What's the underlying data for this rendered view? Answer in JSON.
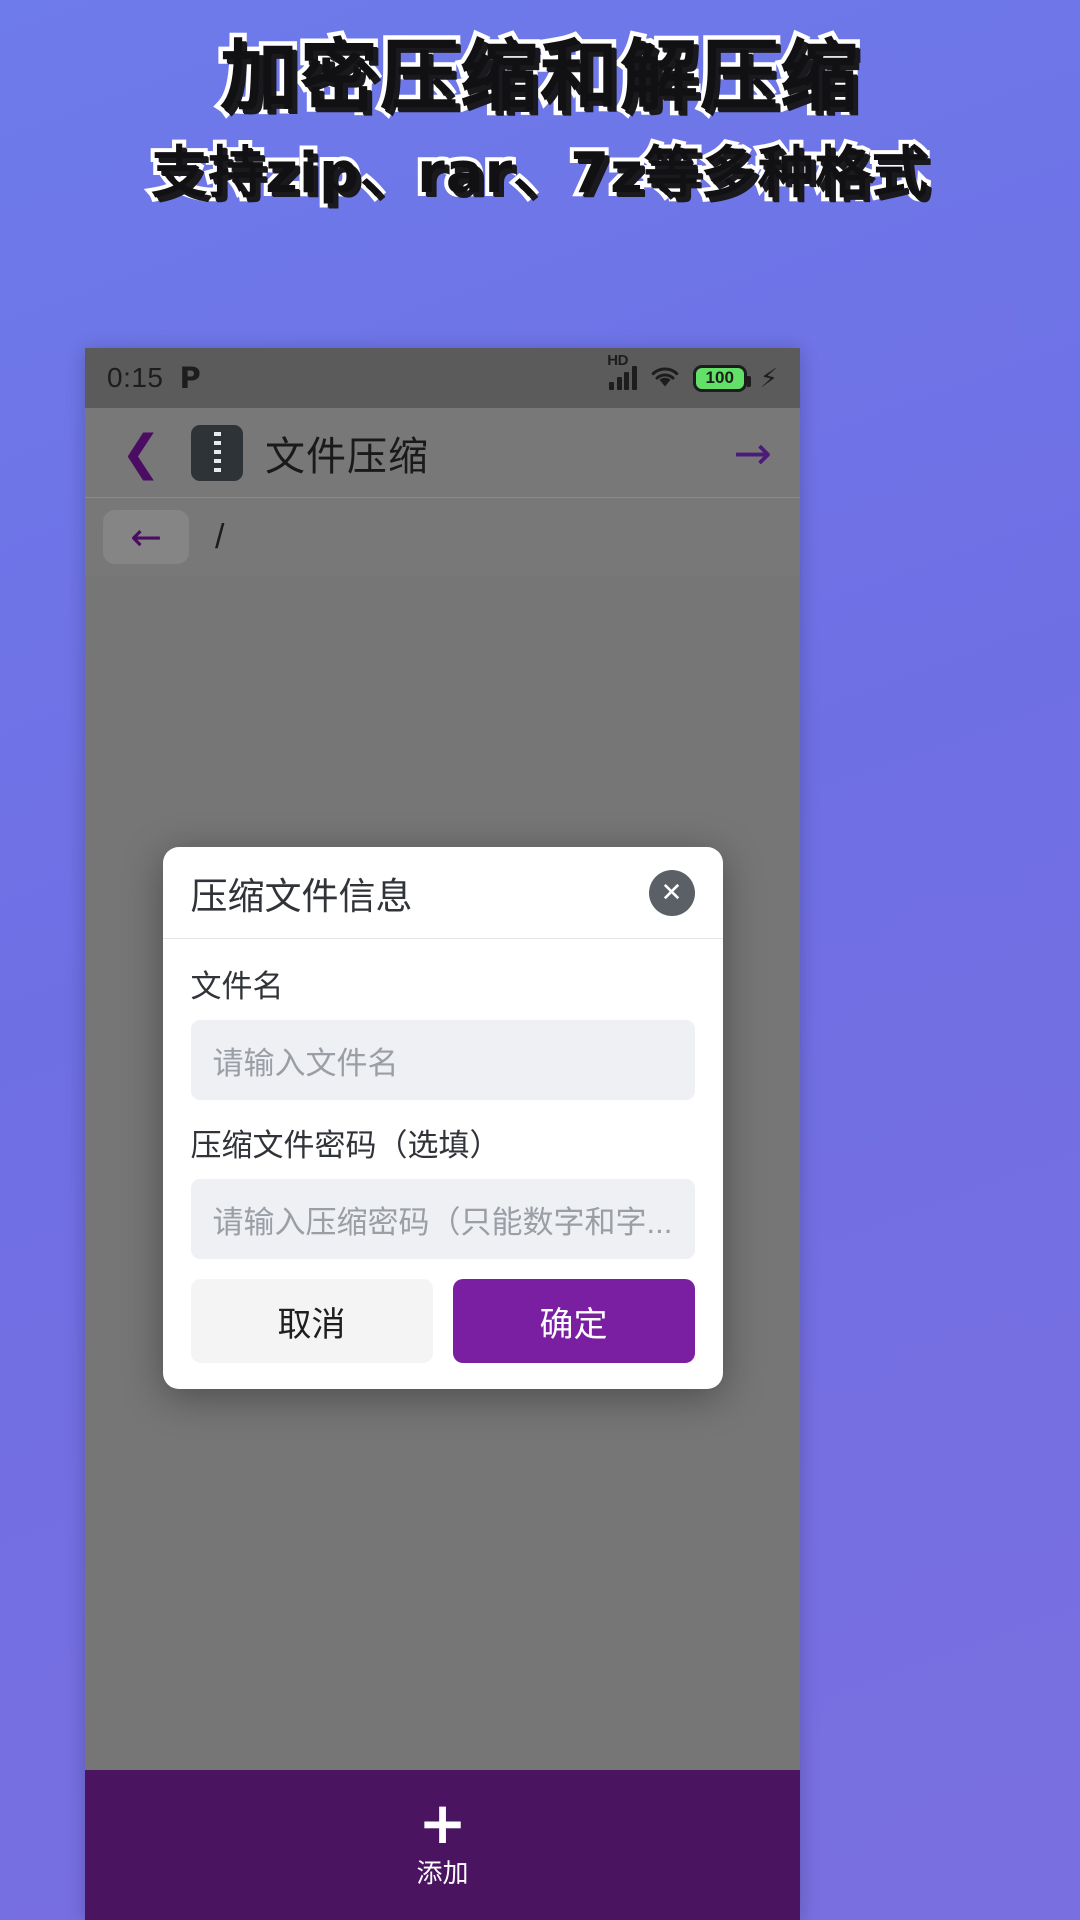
{
  "promo": {
    "title": "加密压缩和解压缩",
    "subtitle": "支持zip、rar、7z等多种格式",
    "bg_color": "#6f6fe4"
  },
  "statusbar": {
    "time": "0:15",
    "app_badge": "P",
    "network_label": "HD",
    "signal_icon": "signal-bars-icon",
    "wifi_icon": "wifi-icon",
    "battery_level": "100",
    "battery_color": "#63e067",
    "charging_icon": "lightning-bolt-icon"
  },
  "appbar": {
    "back_icon": "chevron-left-icon",
    "app_icon": "zip-archive-icon",
    "title": "文件压缩",
    "forward_icon": "arrow-right-icon",
    "accent_color": "#4a1b7a"
  },
  "pathbar": {
    "back_icon": "arrow-left-icon",
    "path": "/"
  },
  "dialog": {
    "title": "压缩文件信息",
    "close_icon": "close-circle-icon",
    "fields": [
      {
        "label": "文件名",
        "placeholder": "请输入文件名",
        "value": ""
      },
      {
        "label": "压缩文件密码（选填）",
        "placeholder": "请输入压缩密码（只能数字和字...",
        "value": ""
      }
    ],
    "cancel_label": "取消",
    "confirm_label": "确定",
    "confirm_color": "#7b1fa2"
  },
  "bottombar": {
    "add_icon": "plus-icon",
    "add_label": "添加",
    "bg_color": "#4a1460"
  }
}
